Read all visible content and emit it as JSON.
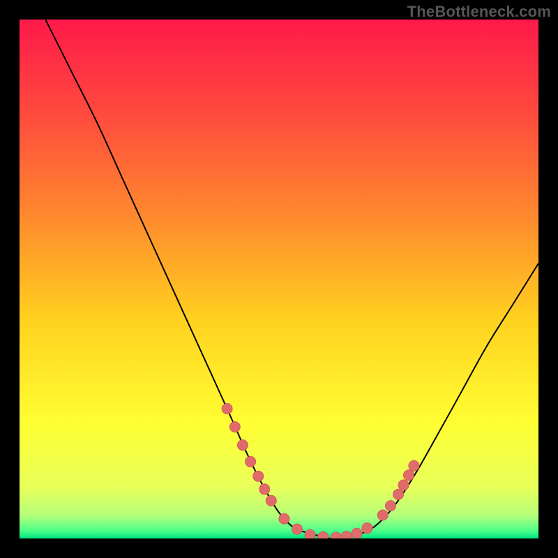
{
  "watermark": "TheBottleneck.com",
  "colors": {
    "page_bg": "#000000",
    "gradient_stops": [
      {
        "offset": 0.0,
        "color": "#ff1a4b"
      },
      {
        "offset": 0.18,
        "color": "#ff4a3e"
      },
      {
        "offset": 0.38,
        "color": "#ff8a2e"
      },
      {
        "offset": 0.58,
        "color": "#ffd21f"
      },
      {
        "offset": 0.78,
        "color": "#ffff33"
      },
      {
        "offset": 0.9,
        "color": "#e9ff5a"
      },
      {
        "offset": 0.955,
        "color": "#b7ff7a"
      },
      {
        "offset": 0.985,
        "color": "#4eff8a"
      },
      {
        "offset": 1.0,
        "color": "#00e481"
      }
    ],
    "curve_stroke": "#000000",
    "marker_fill": "#e06b6b",
    "marker_stroke": "#d45a5a"
  },
  "chart_data": {
    "type": "line",
    "title": "",
    "xlabel": "",
    "ylabel": "",
    "xlim": [
      0,
      100
    ],
    "ylim": [
      0,
      100
    ],
    "grid": false,
    "series": [
      {
        "name": "bottleneck-curve",
        "x": [
          5,
          10,
          15,
          20,
          25,
          30,
          35,
          40,
          44,
          47,
          50,
          53,
          56,
          60,
          64,
          68,
          72,
          76,
          80,
          85,
          90,
          95,
          100
        ],
        "y": [
          100,
          90,
          80,
          69,
          58,
          47,
          36,
          25,
          16,
          10,
          5,
          2,
          1,
          0,
          0.5,
          2,
          6,
          12,
          19,
          28,
          37,
          45,
          53
        ]
      }
    ],
    "markers": {
      "name": "highlight-points",
      "comment": "approximate dot positions along the curve, in chart-space (0-100)",
      "points": [
        {
          "x": 40.0,
          "y": 25.0
        },
        {
          "x": 41.5,
          "y": 21.5
        },
        {
          "x": 43.0,
          "y": 18.0
        },
        {
          "x": 44.5,
          "y": 14.8
        },
        {
          "x": 46.0,
          "y": 12.0
        },
        {
          "x": 47.2,
          "y": 9.5
        },
        {
          "x": 48.5,
          "y": 7.3
        },
        {
          "x": 51.0,
          "y": 3.8
        },
        {
          "x": 53.5,
          "y": 1.8
        },
        {
          "x": 56.0,
          "y": 0.7
        },
        {
          "x": 58.5,
          "y": 0.3
        },
        {
          "x": 61.0,
          "y": 0.2
        },
        {
          "x": 63.0,
          "y": 0.4
        },
        {
          "x": 65.0,
          "y": 1.0
        },
        {
          "x": 67.0,
          "y": 2.0
        },
        {
          "x": 70.0,
          "y": 4.5
        },
        {
          "x": 71.5,
          "y": 6.3
        },
        {
          "x": 73.0,
          "y": 8.5
        },
        {
          "x": 74.0,
          "y": 10.3
        },
        {
          "x": 75.0,
          "y": 12.2
        },
        {
          "x": 76.0,
          "y": 14.0
        }
      ]
    }
  }
}
